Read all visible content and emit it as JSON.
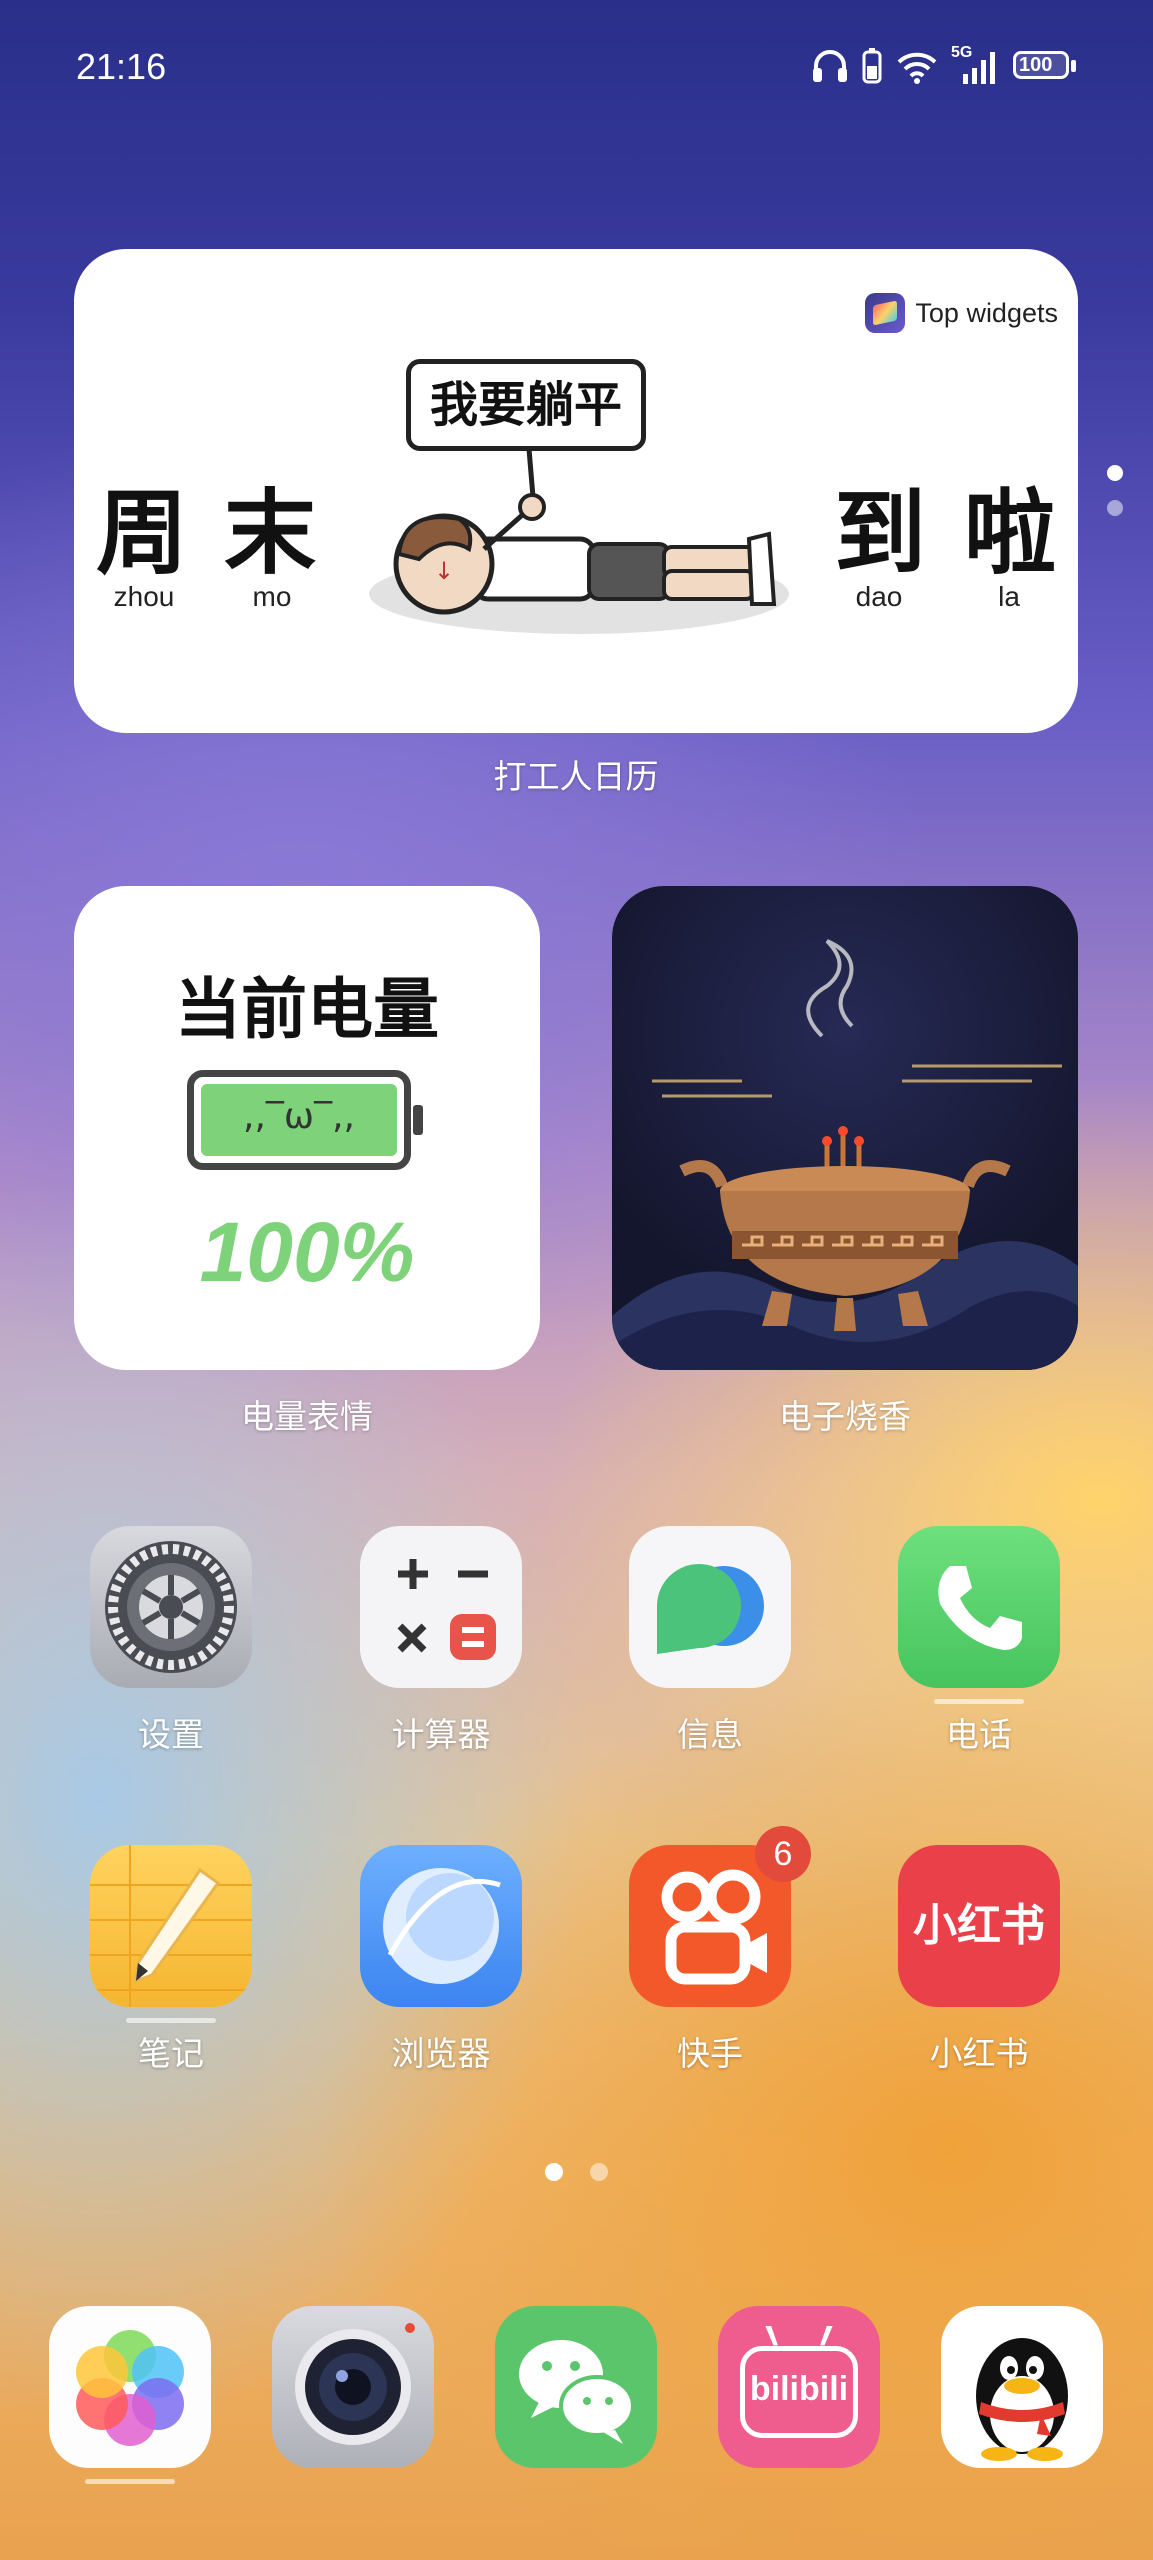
{
  "status_bar": {
    "time": "21:16",
    "signal_label": "5G",
    "battery_level": "100"
  },
  "calendar_widget": {
    "brand": "Top widgets",
    "chars": [
      "周",
      "末",
      "到",
      "啦"
    ],
    "pinyin": [
      "zhou",
      "mo",
      "dao",
      "la"
    ],
    "sign_text": "我要躺平",
    "label": "打工人日历"
  },
  "battery_widget": {
    "title": "当前电量",
    "face": ",,‾ω‾,,",
    "percent": "100%",
    "label": "电量表情"
  },
  "incense_widget": {
    "label": "电子烧香"
  },
  "apps": [
    {
      "name": "设置",
      "icon": "settings-gear-icon"
    },
    {
      "name": "计算器",
      "icon": "calculator-icon"
    },
    {
      "name": "信息",
      "icon": "messages-icon"
    },
    {
      "name": "电话",
      "icon": "phone-icon"
    },
    {
      "name": "笔记",
      "icon": "notes-icon"
    },
    {
      "name": "浏览器",
      "icon": "browser-icon"
    },
    {
      "name": "快手",
      "icon": "kuaishou-icon",
      "badge": "6"
    },
    {
      "name": "小红书",
      "icon": "xiaohongshu-icon",
      "logo_text": "小红书"
    }
  ],
  "dock": [
    {
      "icon": "photos-icon"
    },
    {
      "icon": "camera-icon"
    },
    {
      "icon": "wechat-icon"
    },
    {
      "icon": "bilibili-icon",
      "logo_text": "bilibili"
    },
    {
      "icon": "qq-penguin-icon"
    }
  ],
  "colors": {
    "battery_green": "#7ed37a",
    "badge_red": "#e24a3b",
    "xiaohongshu_red": "#e9404a",
    "kuaishou_orange": "#f2582a",
    "wechat_green": "#5bc56b",
    "bilibili_pink": "#ee5d8d"
  }
}
